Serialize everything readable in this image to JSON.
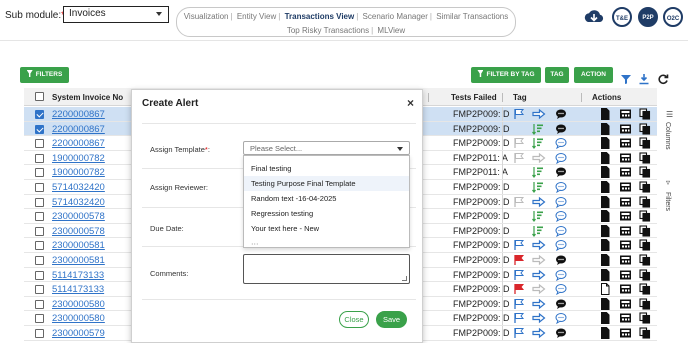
{
  "header": {
    "submodule_label": "Sub module:",
    "submodule_required": "*",
    "submodule_value": "Invoices",
    "nav_row1": [
      "Visualization",
      "Entity View",
      "Transactions View",
      "Scenario Manager",
      "Similar Transactions"
    ],
    "nav_row2": [
      "Top Risky Transactions",
      "MLView"
    ],
    "nav_active": "Transactions View",
    "circle_buttons": [
      "T&E",
      "P2P",
      "O2C"
    ],
    "brand_color": "#1f3c66"
  },
  "toolbar": {
    "filters_label": "FILTERS",
    "filter_by_tag_label": "FILTER BY TAG",
    "tag_label": "TAG",
    "action_label": "ACTION",
    "accent_color": "#3aa14a"
  },
  "side_panel": {
    "columns_label": "Columns",
    "filters_label": "Filters"
  },
  "grid": {
    "headers": {
      "invoice": "System Invoice No",
      "tests_failed": "Tests Failed",
      "tag": "Tag",
      "actions": "Actions"
    },
    "rows": [
      {
        "invoice": "2200000867",
        "tests": "FMP2P009: D",
        "selected": true,
        "flag": "blue",
        "arrow": "blue",
        "bars": false,
        "comment": "dark"
      },
      {
        "invoice": "2200000867",
        "tests": "FMP2P009: D",
        "selected": true,
        "flag": "none",
        "arrow": "none",
        "bars": true,
        "comment": "dark"
      },
      {
        "invoice": "2200000867",
        "tests": "FMP2P009: D",
        "selected": false,
        "flag": "grey",
        "arrow": "none",
        "bars": true,
        "comment": "blue"
      },
      {
        "invoice": "1900000782",
        "tests": "FMP2P011: A",
        "selected": false,
        "flag": "grey",
        "arrow": "grey",
        "bars": false,
        "comment": "blue"
      },
      {
        "invoice": "1900000782",
        "tests": "FMP2P011: A",
        "selected": false,
        "flag": "none",
        "arrow": "none",
        "bars": true,
        "comment": "dark"
      },
      {
        "invoice": "5714032420",
        "tests": "FMP2P009: D",
        "selected": false,
        "flag": "none",
        "arrow": "none",
        "bars": true,
        "comment": "blue"
      },
      {
        "invoice": "5714032420",
        "tests": "FMP2P009: D",
        "selected": false,
        "flag": "grey",
        "arrow": "blue",
        "bars": false,
        "comment": "blue"
      },
      {
        "invoice": "2300000578",
        "tests": "FMP2P009: D",
        "selected": false,
        "flag": "none",
        "arrow": "none",
        "bars": true,
        "comment": "blue"
      },
      {
        "invoice": "2300000578",
        "tests": "FMP2P009: D",
        "selected": false,
        "flag": "none",
        "arrow": "none",
        "bars": true,
        "comment": "blue"
      },
      {
        "invoice": "2300000581",
        "tests": "FMP2P009: D",
        "selected": false,
        "flag": "blue",
        "arrow": "blue",
        "bars": false,
        "comment": "blue"
      },
      {
        "invoice": "2300000581",
        "tests": "FMP2P009: D",
        "selected": false,
        "flag": "red",
        "arrow": "grey",
        "bars": false,
        "comment": "dark"
      },
      {
        "invoice": "5114173133",
        "tests": "FMP2P009: D",
        "selected": false,
        "flag": "blue",
        "arrow": "blue",
        "bars": false,
        "comment": "blue"
      },
      {
        "invoice": "5114173133",
        "tests": "FMP2P009: D",
        "selected": false,
        "flag": "red",
        "arrow": "grey",
        "bars": false,
        "comment": "blue"
      },
      {
        "invoice": "2300000580",
        "tests": "FMP2P009: D",
        "selected": false,
        "flag": "blue",
        "arrow": "blue",
        "bars": false,
        "comment": "dark"
      },
      {
        "invoice": "2300000580",
        "tests": "FMP2P009: D",
        "selected": false,
        "flag": "blue",
        "arrow": "blue",
        "bars": false,
        "comment": "blue"
      },
      {
        "invoice": "2300000579",
        "tests": "FMP2P009: D",
        "selected": false,
        "flag": "blue",
        "arrow": "blue",
        "bars": false,
        "comment": "dark"
      }
    ]
  },
  "modal": {
    "title": "Create Alert",
    "assign_template_label": "Assign Template",
    "required_mark": "*",
    "label_colon": ":",
    "assign_reviewer_label": "Assign Reviewer:",
    "due_date_label": "Due Date:",
    "comments_label": "Comments:",
    "select_placeholder": "Please Select...",
    "options": [
      "Final testing",
      "Testing Purpose Final Template",
      "Random text -16-04-2025",
      "Regression testing",
      "Your text here - New"
    ],
    "highlighted_option": "Testing Purpose Final Template",
    "close_label": "Close",
    "save_label": "Save"
  }
}
